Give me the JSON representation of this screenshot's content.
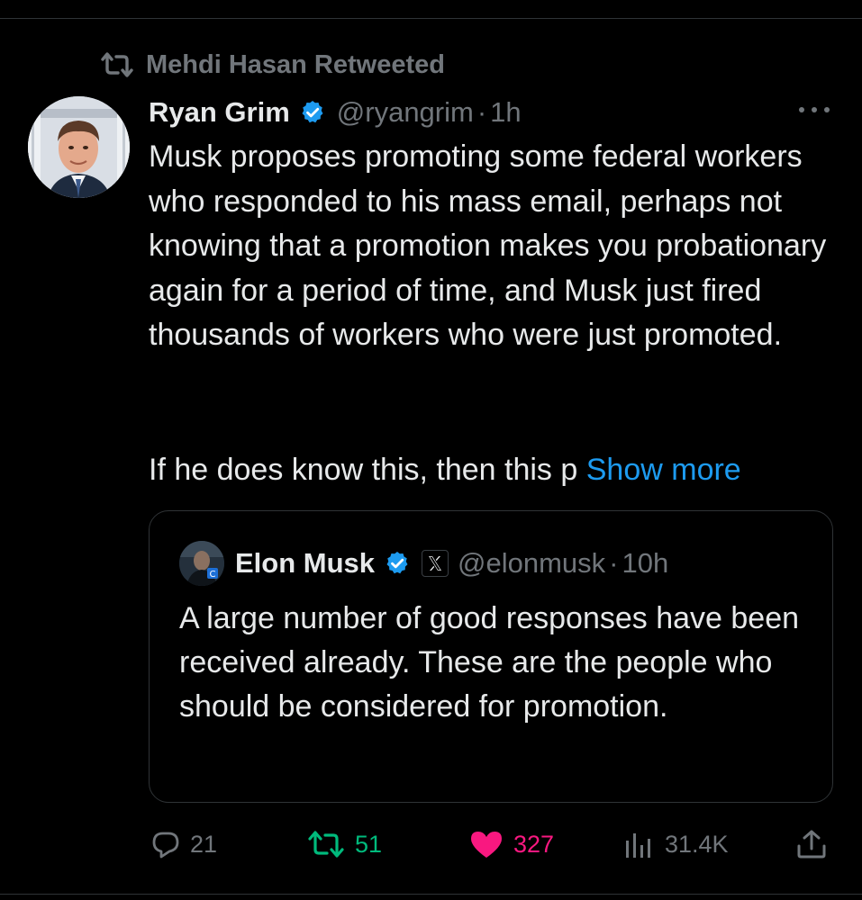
{
  "retweet_context": {
    "text": "Mehdi Hasan Retweeted",
    "icon": "retweet-icon"
  },
  "tweet": {
    "author_name": "Ryan Grim",
    "verified": true,
    "handle": "@ryangrim",
    "separator": "·",
    "time": "1h",
    "more_icon": "more-horizontal-icon",
    "text_paragraph_1": "Musk proposes promoting some federal workers who responded to his mass email, perhaps not knowing that a promotion makes you probationary again for a period of time, and Musk just fired thousands of workers who were just promoted.",
    "text_paragraph_2": "If he does know this, then this p",
    "show_more_label": "Show more",
    "link_color": "#1d9bf0"
  },
  "quoted_tweet": {
    "author_name": "Elon Musk",
    "verified": true,
    "affiliation_badge": "X",
    "handle": "@elonmusk",
    "separator": "·",
    "time": "10h",
    "text": "A large number of good responses have been received already. These are the people who should be considered for promotion."
  },
  "actions": {
    "replies": "21",
    "retweets": "51",
    "likes": "327",
    "views": "31.4K",
    "retweet_color": "#00ba7c",
    "like_color": "#f91880"
  }
}
